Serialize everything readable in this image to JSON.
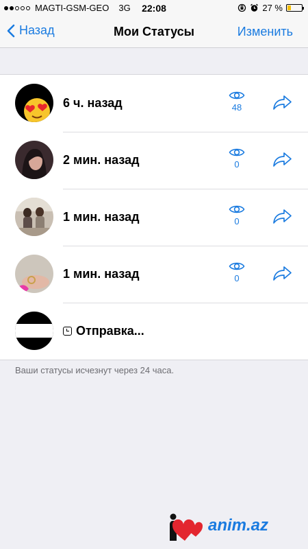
{
  "status_bar": {
    "carrier": "MAGTI-GSM-GEO",
    "network": "3G",
    "time": "22:08",
    "battery_percent": "27 %",
    "battery_level": 0.27,
    "signal_bars": 2
  },
  "nav": {
    "back_label": "Назад",
    "title": "Мои Статусы",
    "edit_label": "Изменить"
  },
  "statuses": [
    {
      "time": "6 ч. назад",
      "views": "48"
    },
    {
      "time": "2 мин. назад",
      "views": "0"
    },
    {
      "time": "1 мин. назад",
      "views": "0"
    },
    {
      "time": "1 мин. назад",
      "views": "0"
    }
  ],
  "sending": {
    "label": "Отправка..."
  },
  "footnote": "Ваши статусы исчезнут через 24 часа.",
  "watermark": {
    "text": "anim.az"
  },
  "colors": {
    "accent": "#1a7be0",
    "background": "#efeff4",
    "battery": "#f5c000"
  }
}
